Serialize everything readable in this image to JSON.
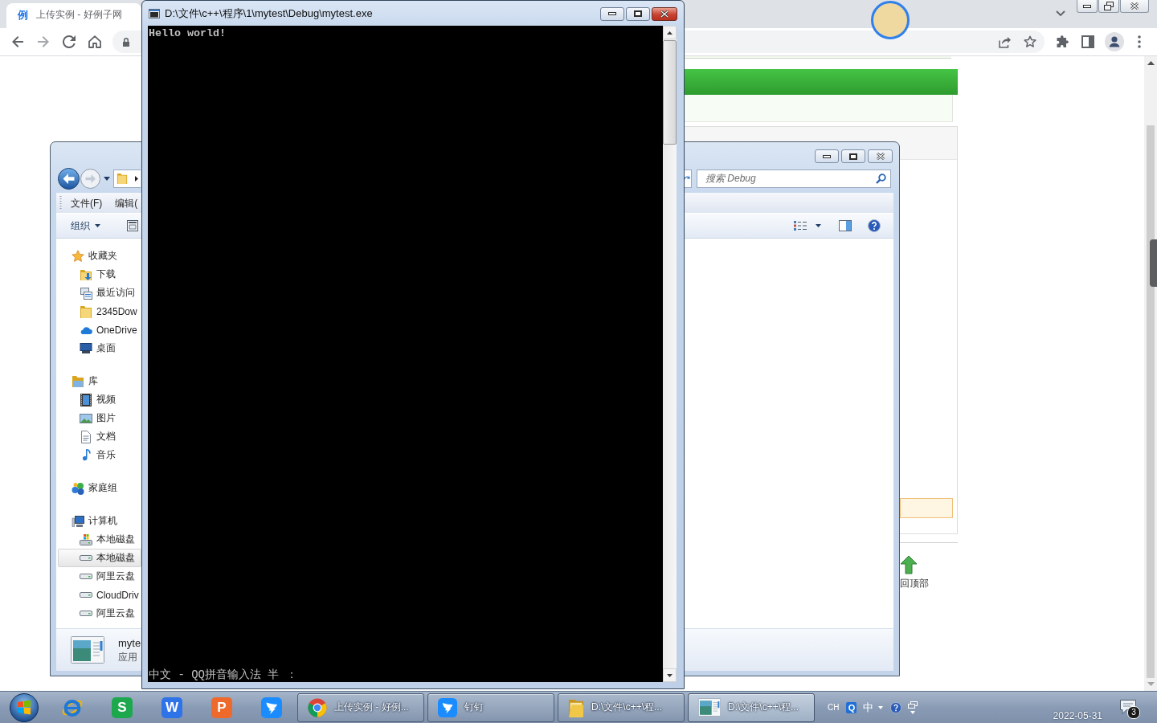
{
  "browser": {
    "tabs": [
      {
        "favicon": "例",
        "title": "上传实例 - 好例子网",
        "selected": true
      }
    ],
    "page": {
      "back_to_top": "回顶部"
    }
  },
  "explorer": {
    "search": {
      "placeholder": "搜索 Debug"
    },
    "menu": [
      "文件(F)",
      "编辑("
    ],
    "command_bar": {
      "organize": "组织"
    },
    "nav_pane": [
      {
        "label": "收藏夹",
        "kind": "favorites",
        "selected": false,
        "children": [
          {
            "label": "下载",
            "kind": "downloads",
            "selected": false
          },
          {
            "label": "最近访问",
            "kind": "recent",
            "selected": false
          },
          {
            "label": "2345Dow",
            "kind": "folder",
            "selected": false
          },
          {
            "label": "OneDrive",
            "kind": "cloud",
            "selected": false
          },
          {
            "label": "桌面",
            "kind": "desktop",
            "selected": false
          }
        ]
      },
      {
        "label": "库",
        "kind": "library",
        "selected": false,
        "children": [
          {
            "label": "视频",
            "kind": "video",
            "selected": false
          },
          {
            "label": "图片",
            "kind": "pictures",
            "selected": false
          },
          {
            "label": "文档",
            "kind": "documents",
            "selected": false
          },
          {
            "label": "音乐",
            "kind": "music",
            "selected": false
          }
        ]
      },
      {
        "label": "家庭组",
        "kind": "homegroup",
        "selected": false
      },
      {
        "label": "计算机",
        "kind": "computer",
        "selected": false,
        "children": [
          {
            "label": "本地磁盘",
            "kind": "system-drive",
            "selected": false
          },
          {
            "label": "本地磁盘",
            "kind": "drive",
            "selected": true
          },
          {
            "label": "阿里云盘",
            "kind": "drive",
            "selected": false
          },
          {
            "label": "CloudDriv",
            "kind": "drive",
            "selected": false
          },
          {
            "label": "阿里云盘",
            "kind": "drive",
            "selected": false
          }
        ]
      }
    ],
    "details": {
      "name": "myte",
      "type": "应用"
    }
  },
  "console": {
    "title": "D:\\文件\\c++\\程序\\1\\mytest\\Debug\\mytest.exe",
    "lines": [
      "Hello world!"
    ],
    "ime_status": "中文 - QQ拼音输入法 半 ："
  },
  "taskbar": {
    "pinned": [
      {
        "kind": "browser"
      },
      {
        "kind": "tile",
        "glyph": "S",
        "color": "#1ea84e"
      },
      {
        "kind": "tile",
        "glyph": "W",
        "color": "#2f73e8"
      },
      {
        "kind": "tile",
        "glyph": "P",
        "color": "#ee6a2c"
      },
      {
        "kind": "messenger"
      }
    ],
    "windows": [
      {
        "label": "上传实例 - 好例...",
        "kind": "chrome",
        "selected": false
      },
      {
        "label": "钉钉",
        "kind": "messenger",
        "selected": false
      },
      {
        "label": "D:\\文件\\c++\\程...",
        "kind": "folder",
        "selected": false
      },
      {
        "label": "D:\\文件\\c++\\程...",
        "kind": "console",
        "selected": true
      }
    ],
    "tray": {
      "language": "CH",
      "ime_logo": "Q",
      "ime_mode": "中",
      "date": "2022-05-31",
      "notification_count": "3"
    }
  }
}
